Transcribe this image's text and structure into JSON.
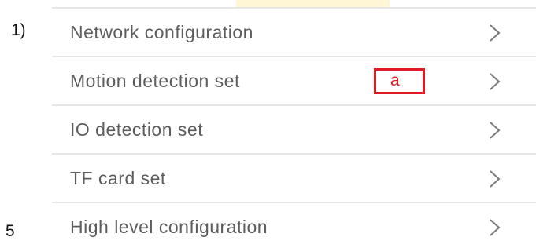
{
  "annotations": {
    "step_start": "1)",
    "step_end": "5",
    "callout_letter": "a"
  },
  "menu": {
    "items": [
      {
        "label": "Network configuration",
        "icon": "chevron-right-icon"
      },
      {
        "label": "Motion detection set",
        "icon": "chevron-right-icon"
      },
      {
        "label": "IO detection set",
        "icon": "chevron-right-icon"
      },
      {
        "label": "TF card set",
        "icon": "chevron-right-icon"
      },
      {
        "label": "High level configuration",
        "icon": "chevron-right-icon"
      }
    ]
  },
  "colors": {
    "label_text": "#5d5d5d",
    "divider": "#e6e6e6",
    "annotation_red": "#e01b24",
    "chevron": "#7a7a7a"
  }
}
